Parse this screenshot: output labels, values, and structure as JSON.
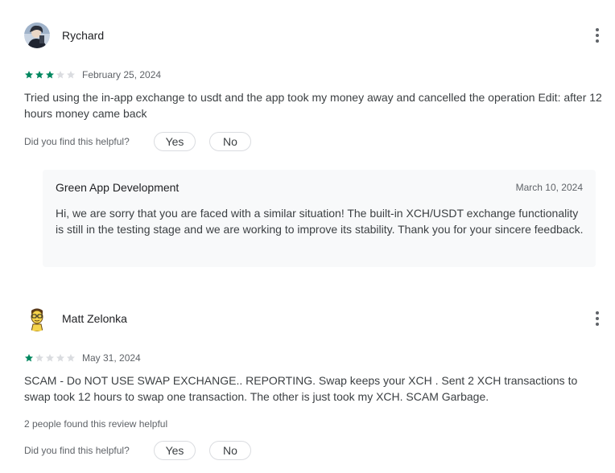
{
  "reviews": [
    {
      "author": "Rychard",
      "avatar_icon": "profile-photo-icon",
      "rating": 3,
      "max_rating": 5,
      "date": "February 25, 2024",
      "text": "Tried using the in-app exchange to usdt and the app took my money away and cancelled the operation Edit: after 12 hours money came back",
      "helpful_question": "Did you find this helpful?",
      "yes_label": "Yes",
      "no_label": "No",
      "developer_reply": {
        "developer": "Green App Development",
        "date": "March 10, 2024",
        "text": "Hi, we are sorry that you are faced with a similar situation! The built-in XCH/USDT exchange functionality is still in the testing stage and we are working to improve its stability. Thank you for your sincere feedback."
      }
    },
    {
      "author": "Matt Zelonka",
      "avatar_icon": "cartoon-face-icon",
      "rating": 1,
      "max_rating": 5,
      "date": "May 31, 2024",
      "text": "SCAM - Do NOT USE SWAP EXCHANGE.. REPORTING. Swap keeps your XCH . Sent 2 XCH transactions to swap took 12 hours to swap one transaction. The other is just took my XCH. SCAM Garbage.",
      "helpful_count_text": "2 people found this review helpful",
      "helpful_question": "Did you find this helpful?",
      "yes_label": "Yes",
      "no_label": "No"
    }
  ],
  "colors": {
    "star_filled": "#01875f",
    "star_empty": "#dadce0",
    "reply_bg": "#f8f9fa"
  }
}
